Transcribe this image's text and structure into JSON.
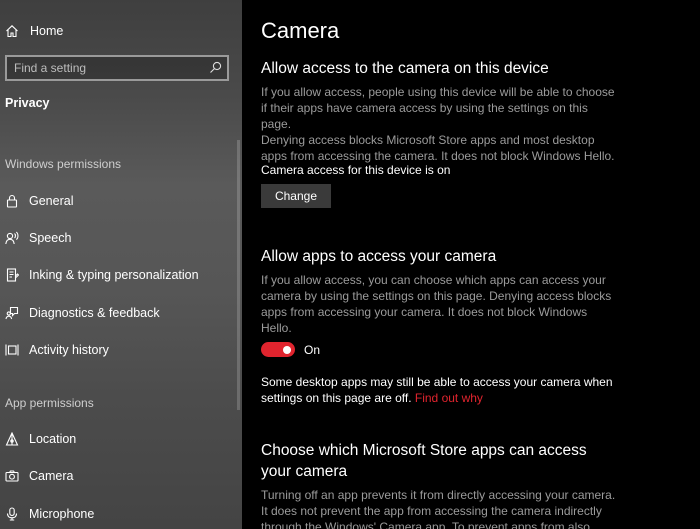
{
  "sidebar": {
    "home_label": "Home",
    "search_placeholder": "Find a setting",
    "section_title": "Privacy",
    "windows_permissions_header": "Windows permissions",
    "windows_items": [
      {
        "label": "General",
        "icon": "lock-icon"
      },
      {
        "label": "Speech",
        "icon": "speech-icon"
      },
      {
        "label": "Inking & typing personalization",
        "icon": "inking-icon"
      },
      {
        "label": "Diagnostics & feedback",
        "icon": "feedback-icon"
      },
      {
        "label": "Activity history",
        "icon": "activity-icon"
      }
    ],
    "app_permissions_header": "App permissions",
    "app_items": [
      {
        "label": "Location",
        "icon": "location-icon"
      },
      {
        "label": "Camera",
        "icon": "camera-icon"
      },
      {
        "label": "Microphone",
        "icon": "microphone-icon"
      }
    ]
  },
  "main": {
    "title": "Camera",
    "device_section": {
      "heading": "Allow access to the camera on this device",
      "description_lines": [
        "If you allow access, people using this device will be able to choose",
        "if their apps have camera access by using the settings on this page.",
        "Denying access blocks Microsoft Store apps and most desktop",
        "apps from accessing the camera. It does not block Windows Hello."
      ],
      "status": "Camera access for this device is on",
      "change_label": "Change"
    },
    "apps_section": {
      "heading": "Allow apps to access your camera",
      "description_lines": [
        "If you allow access, you can choose which apps can access your",
        "camera by using the settings on this page. Denying access blocks",
        "apps from accessing your camera. It does not block Windows Hello."
      ],
      "toggle_state": "On",
      "toggle_on": true,
      "note_line1": "Some desktop apps may still be able to access your camera when",
      "note_line2": "settings on this page are off.",
      "note_link": "Find out why"
    },
    "store_section": {
      "heading_lines": [
        "Choose which Microsoft Store apps can access",
        "your camera"
      ],
      "description_lines": [
        "Turning off an app prevents it from directly accessing your camera.",
        "It does not prevent the app from accessing the camera indirectly",
        "through the Windows' Camera app. To prevent apps from also"
      ]
    }
  },
  "colors": {
    "accent": "#e0242e",
    "background": "#000000",
    "secondary_text": "#9b9b9b",
    "button_bg": "#3a3a3a"
  }
}
